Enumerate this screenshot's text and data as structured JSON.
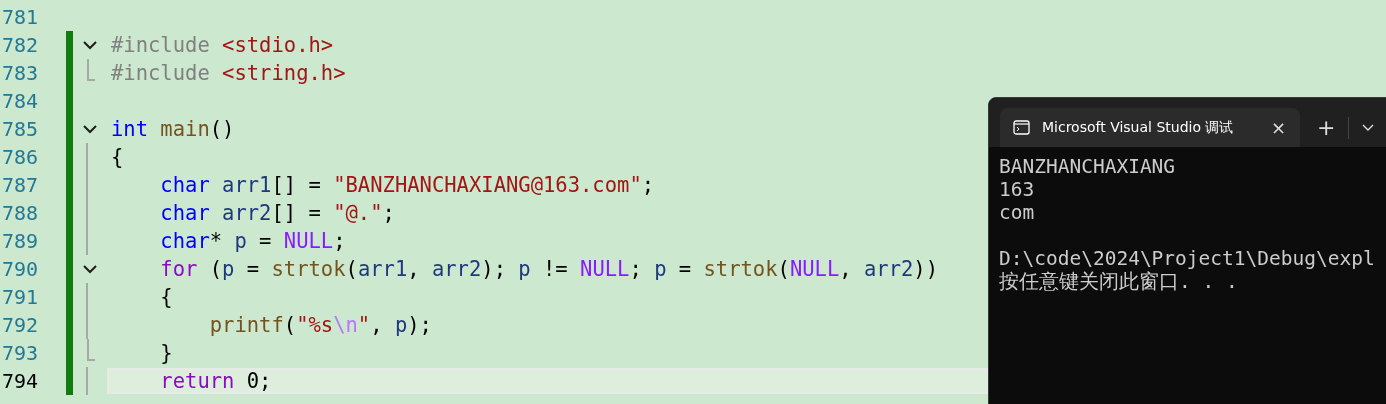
{
  "editor": {
    "lines": [
      {
        "number": "781",
        "changed": false,
        "current": false,
        "kind": "plain"
      },
      {
        "number": "782",
        "changed": true,
        "current": false,
        "kind": "fold_start",
        "tokens": [
          {
            "kind": "directive",
            "text": "#include"
          },
          {
            "kind": "header",
            "text": " <stdio.h>"
          }
        ]
      },
      {
        "number": "783",
        "changed": true,
        "current": false,
        "kind": "fold_end",
        "tokens": [
          {
            "kind": "directive",
            "text": "#include"
          },
          {
            "kind": "header",
            "text": " <string.h>"
          }
        ]
      },
      {
        "number": "784",
        "changed": true,
        "current": false,
        "kind": "plain"
      },
      {
        "number": "785",
        "changed": true,
        "current": false,
        "kind": "fold_start",
        "tokens": [
          {
            "kind": "keyword",
            "text": "int"
          },
          {
            "kind": "function",
            "text": " main"
          },
          {
            "kind": "plain",
            "text": "()"
          }
        ]
      },
      {
        "number": "786",
        "changed": true,
        "current": false,
        "kind": "body",
        "tokens": [
          {
            "kind": "plain",
            "text": "{"
          }
        ]
      },
      {
        "number": "787",
        "changed": true,
        "current": false,
        "kind": "body",
        "tokens": [
          {
            "kind": "keyword",
            "text": "    char"
          },
          {
            "kind": "variable",
            "text": " arr1"
          },
          {
            "kind": "plain",
            "text": "[] = "
          },
          {
            "kind": "string",
            "text": "\"BANZHANCHAXIANG@163.com\""
          },
          {
            "kind": "plain",
            "text": ";"
          }
        ]
      },
      {
        "number": "788",
        "changed": true,
        "current": false,
        "kind": "body",
        "tokens": [
          {
            "kind": "keyword",
            "text": "    char"
          },
          {
            "kind": "variable",
            "text": " arr2"
          },
          {
            "kind": "plain",
            "text": "[] = "
          },
          {
            "kind": "string",
            "text": "\"@.\""
          },
          {
            "kind": "plain",
            "text": ";"
          }
        ]
      },
      {
        "number": "789",
        "changed": true,
        "current": false,
        "kind": "body",
        "tokens": [
          {
            "kind": "keyword",
            "text": "    char"
          },
          {
            "kind": "plain",
            "text": "* "
          },
          {
            "kind": "variable",
            "text": "p"
          },
          {
            "kind": "plain",
            "text": " = "
          },
          {
            "kind": "macro",
            "text": "NULL"
          },
          {
            "kind": "plain",
            "text": ";"
          }
        ]
      },
      {
        "number": "790",
        "changed": true,
        "current": false,
        "kind": "fold_start",
        "tokens": [
          {
            "kind": "control",
            "text": "    for"
          },
          {
            "kind": "plain",
            "text": " ("
          },
          {
            "kind": "variable",
            "text": "p"
          },
          {
            "kind": "plain",
            "text": " = "
          },
          {
            "kind": "function",
            "text": "strtok"
          },
          {
            "kind": "plain",
            "text": "("
          },
          {
            "kind": "variable",
            "text": "arr1"
          },
          {
            "kind": "plain",
            "text": ", "
          },
          {
            "kind": "variable",
            "text": "arr2"
          },
          {
            "kind": "plain",
            "text": "); "
          },
          {
            "kind": "variable",
            "text": "p"
          },
          {
            "kind": "plain",
            "text": " != "
          },
          {
            "kind": "macro",
            "text": "NULL"
          },
          {
            "kind": "plain",
            "text": "; "
          },
          {
            "kind": "variable",
            "text": "p"
          },
          {
            "kind": "plain",
            "text": " = "
          },
          {
            "kind": "function",
            "text": "strtok"
          },
          {
            "kind": "plain",
            "text": "("
          },
          {
            "kind": "macro",
            "text": "NULL"
          },
          {
            "kind": "plain",
            "text": ", "
          },
          {
            "kind": "variable",
            "text": "arr2"
          },
          {
            "kind": "plain",
            "text": "))"
          }
        ]
      },
      {
        "number": "791",
        "changed": true,
        "current": false,
        "kind": "body",
        "tokens": [
          {
            "kind": "plain",
            "text": "    {"
          }
        ]
      },
      {
        "number": "792",
        "changed": true,
        "current": false,
        "kind": "body",
        "tokens": [
          {
            "kind": "function",
            "text": "        printf"
          },
          {
            "kind": "plain",
            "text": "("
          },
          {
            "kind": "string",
            "text": "\"%s"
          },
          {
            "kind": "escape",
            "text": "\\n"
          },
          {
            "kind": "string",
            "text": "\""
          },
          {
            "kind": "plain",
            "text": ", "
          },
          {
            "kind": "variable",
            "text": "p"
          },
          {
            "kind": "plain",
            "text": ");"
          }
        ]
      },
      {
        "number": "793",
        "changed": true,
        "current": false,
        "kind": "fold_end",
        "tokens": [
          {
            "kind": "plain",
            "text": "    }"
          }
        ]
      },
      {
        "number": "794",
        "changed": true,
        "current": true,
        "kind": "body",
        "tokens": [
          {
            "kind": "control",
            "text": "    return"
          },
          {
            "kind": "plain",
            "text": " 0;"
          }
        ]
      }
    ]
  },
  "terminal": {
    "tab": {
      "title": "Microsoft Visual Studio 调试",
      "close": "×"
    },
    "new_tab": "+",
    "blocks": [
      {
        "lines": [
          "BANZHANCHAXIANG",
          "163",
          "com"
        ]
      },
      {
        "lines": [
          "D:\\code\\2024\\Project1\\Debug\\expl",
          "按任意键关闭此窗口. . ."
        ]
      }
    ]
  }
}
